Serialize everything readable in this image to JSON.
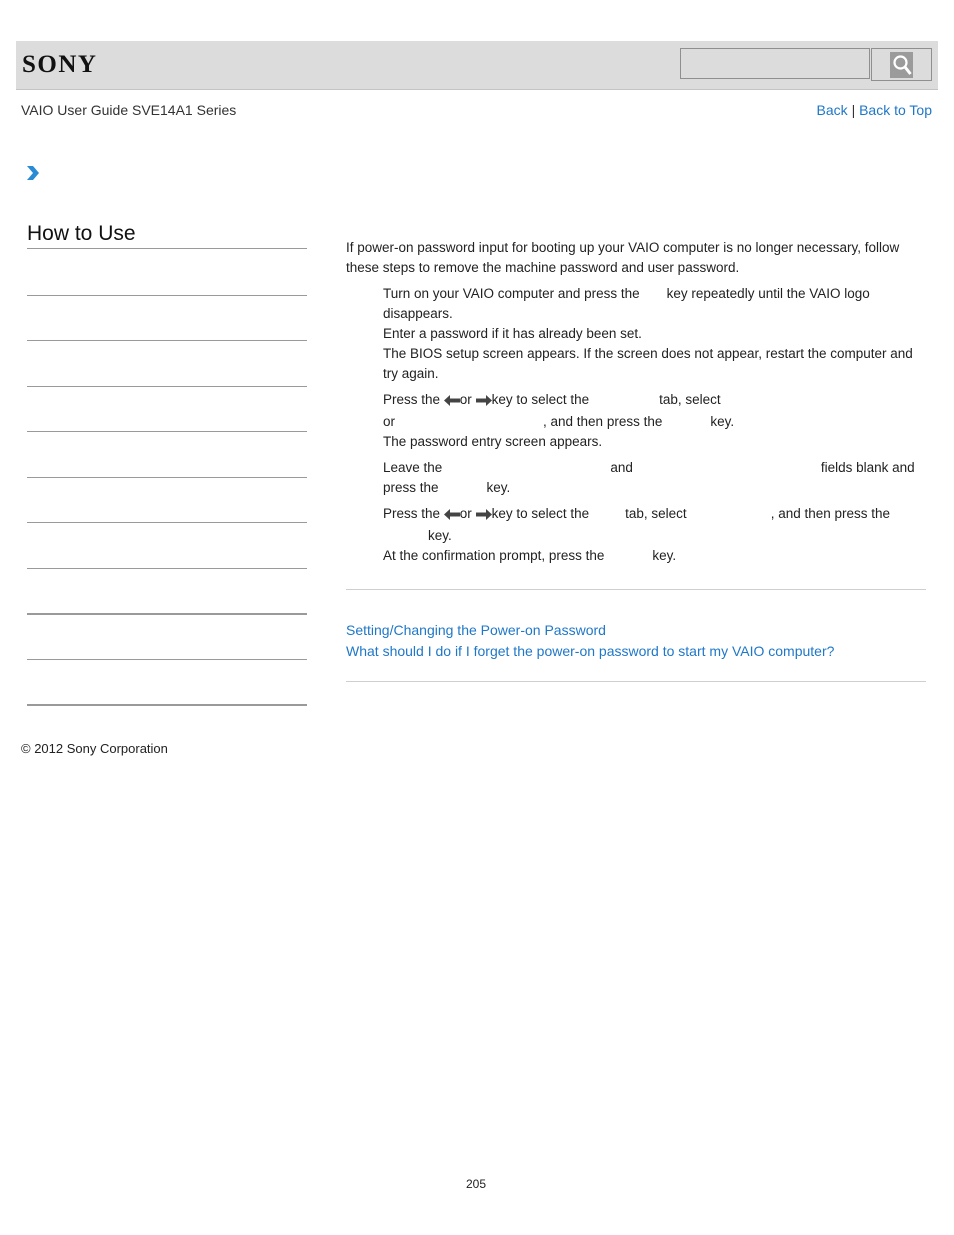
{
  "header": {
    "logo": "SONY",
    "search": {
      "placeholder": "",
      "value": ""
    },
    "search_icon": "magnifier-icon"
  },
  "subheader": {
    "title": "VAIO User Guide SVE14A1 Series",
    "back_label": "Back",
    "separator": "|",
    "back_to_top_label": "Back to Top"
  },
  "sidebar": {
    "heading": "How to Use",
    "items": [
      "",
      "",
      "",
      "",
      "",
      "",
      "",
      "",
      "",
      ""
    ]
  },
  "content": {
    "intro": "If power-on password input for booting up your VAIO computer is no longer necessary, follow these steps to remove the machine password and user password.",
    "steps": [
      {
        "a": "Turn on your VAIO computer and press the",
        "b": "key repeatedly until the VAIO logo disappears.",
        "c": "Enter a password if it has already been set.",
        "d": "The BIOS setup screen appears. If the screen does not appear, restart the computer and try again."
      },
      {
        "a": "Press the",
        "or": "or",
        "b": "key to select the",
        "c": "tab, select",
        "d": "or",
        "e": ", and then press the",
        "f": "key.",
        "g": "The password entry screen appears."
      },
      {
        "a": "Leave the",
        "b": "and",
        "c": "fields blank and press the",
        "d": "key."
      },
      {
        "a": "Press the",
        "or": "or",
        "b": "key to select the",
        "c": "tab, select",
        "d": ", and then press the",
        "e": "key.",
        "f": "At the confirmation prompt, press the",
        "g": "key."
      }
    ]
  },
  "related_links": [
    "Setting/Changing the Power-on Password",
    "What should I do if I forget the power-on password to start my VAIO computer?"
  ],
  "footer": {
    "copyright": "© 2012 Sony Corporation",
    "page_number": "205"
  },
  "colors": {
    "link": "#1f77c8",
    "header_bg": "#dcdcdc",
    "chevron": "#2a8ad4"
  }
}
